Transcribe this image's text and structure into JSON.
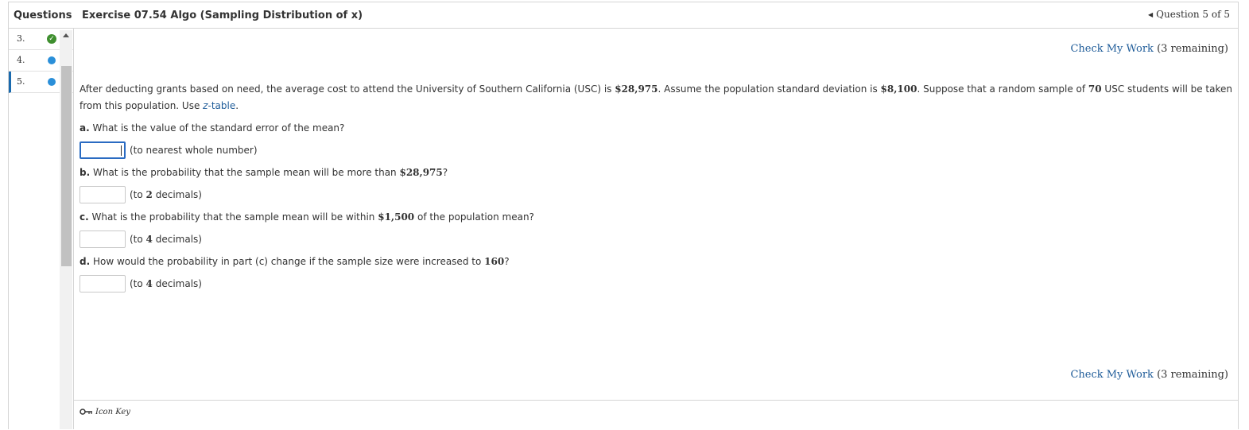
{
  "header": {
    "questions_label": "Questions",
    "exercise_title": "Exercise 07.54 Algo (Sampling Distribution of x)",
    "question_counter": "Question 5 of 5",
    "counter_icon": "left-triangle-icon"
  },
  "question_list": [
    {
      "number": "3.",
      "status": "completed",
      "icon": "checkmark-icon"
    },
    {
      "number": "4.",
      "status": "unanswered",
      "icon": "blue-dot-icon"
    },
    {
      "number": "5.",
      "status": "current",
      "icon": "blue-dot-icon"
    }
  ],
  "check_my_work": {
    "link_label": "Check My Work",
    "remaining": "(3 remaining)"
  },
  "statement": {
    "text1": "After deducting grants based on need, the average cost to attend the University of Southern California (USC) is ",
    "val1": "$28,975",
    "text2": ". Assume the population standard deviation is ",
    "val2": "$8,100",
    "text3": ". Suppose that a random sample of ",
    "val3": "70",
    "text4": " USC students will be taken from this population. Use ",
    "link_z": "z",
    "link_rest": "-table",
    "text5": "."
  },
  "parts": {
    "a": {
      "letter": "a.",
      "q": " What is the value of the standard error of the mean?",
      "hint": "(to nearest whole number)",
      "value": ""
    },
    "b": {
      "letter": "b.",
      "q1": " What is the probability that the sample mean will be more than ",
      "qval": "$28,975",
      "q2": "?",
      "hint_pre": "(to ",
      "hint_num": "2",
      "hint_post": " decimals)",
      "value": ""
    },
    "c": {
      "letter": "c.",
      "q1": " What is the probability that the sample mean will be within ",
      "qval": "$1,500",
      "q2": " of the population mean?",
      "hint_pre": "(to ",
      "hint_num": "4",
      "hint_post": " decimals)",
      "value": ""
    },
    "d": {
      "letter": "d.",
      "q1": " How would the probability in part (c) change if the sample size were increased to ",
      "qval": "160",
      "q2": "?",
      "hint_pre": "(to ",
      "hint_num": "4",
      "hint_post": " decimals)",
      "value": ""
    }
  },
  "footer": {
    "icon_key_label": "Icon Key",
    "key_icon": "key-icon"
  },
  "colors": {
    "link": "#1f5c99",
    "current_marker": "#1a6aae",
    "dot": "#2a8fd9",
    "check": "#3f8f2f",
    "active_input_border": "#2a6bc2"
  }
}
